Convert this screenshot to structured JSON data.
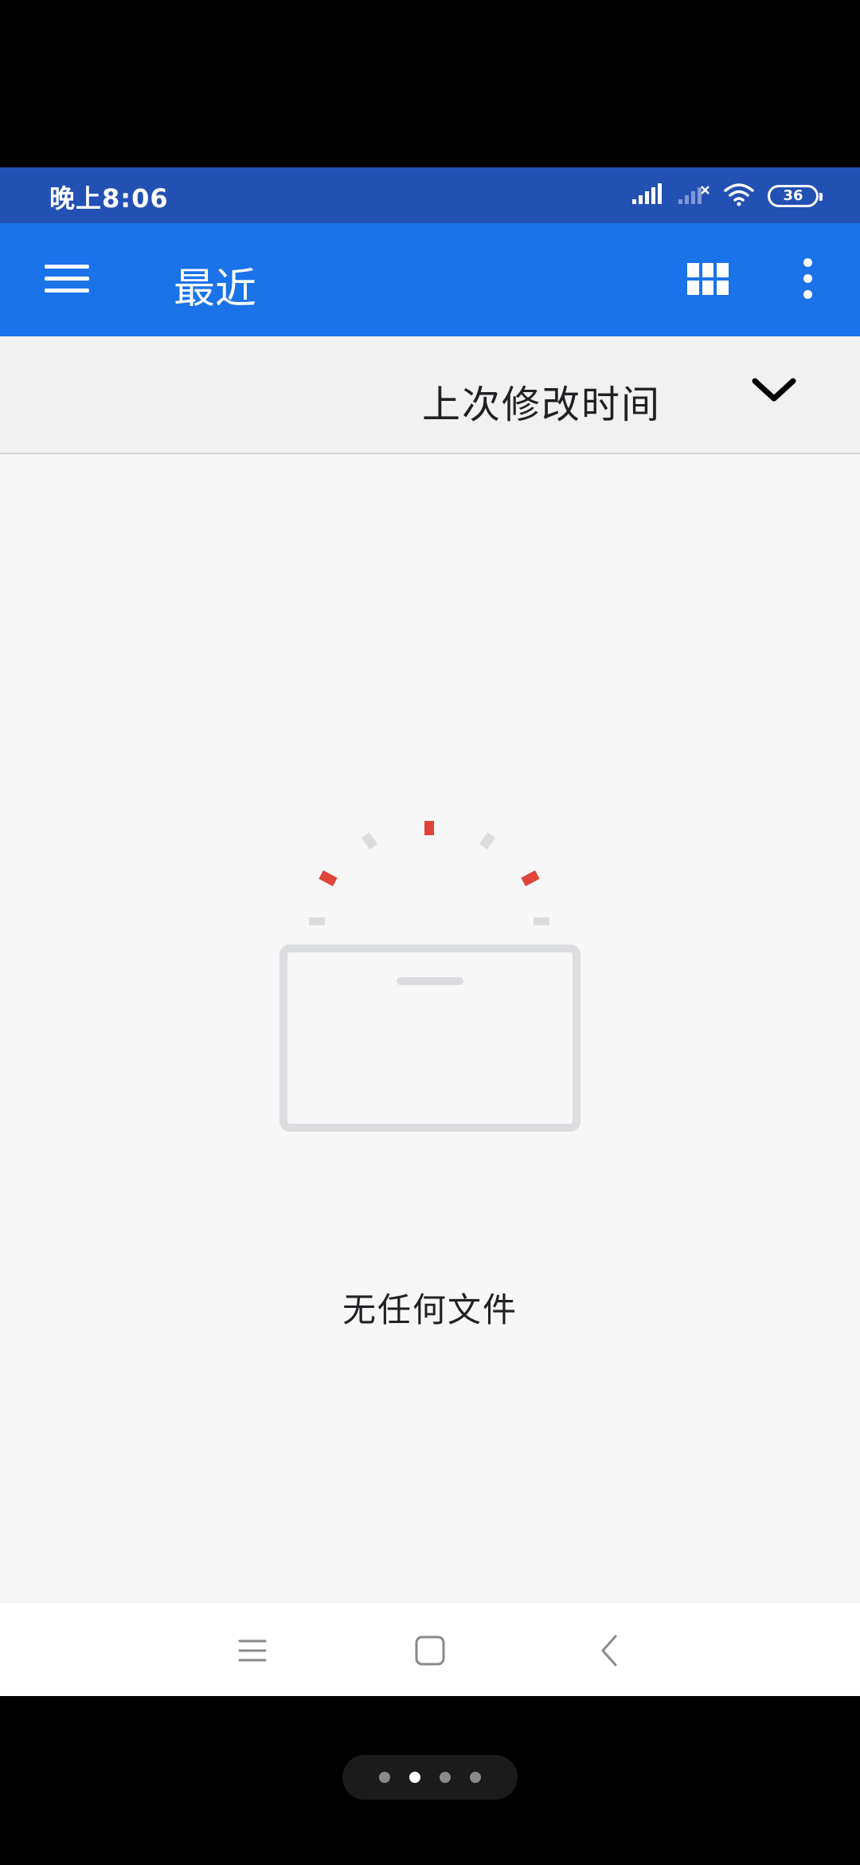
{
  "status_bar": {
    "time": "晚上8:06",
    "battery": "36",
    "icons": [
      "signal-icon",
      "signal-no-sim-icon",
      "wifi-icon",
      "battery-icon"
    ]
  },
  "app_bar": {
    "title": "最近",
    "icons": [
      "menu-icon",
      "grid-view-icon",
      "more-options-icon"
    ],
    "color": "#1a73e8"
  },
  "sort": {
    "label": "上次修改时间"
  },
  "empty_state": {
    "message": "无任何文件",
    "icon": "empty-folder-icon"
  },
  "nav_bar": {
    "icons": [
      "recents-icon",
      "home-icon",
      "back-icon"
    ]
  },
  "page_indicator": {
    "count": 4,
    "active_index": 1
  }
}
